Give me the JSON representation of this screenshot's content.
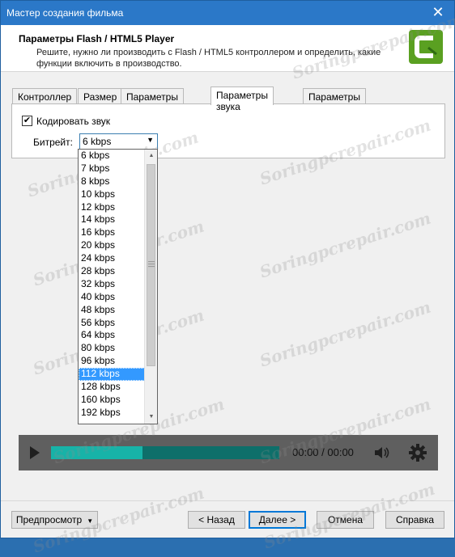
{
  "window": {
    "title": "Мастер создания фильма"
  },
  "header": {
    "title": "Параметры Flash / HTML5 Player",
    "description": "Решите, нужно ли производить с Flash / HTML5 контроллером и определить, какие функции включить в производство."
  },
  "tabs": [
    "Контроллер",
    "Размер",
    "Параметры видео",
    "Параметры звука",
    "Параметры"
  ],
  "active_tab": "Параметры звука",
  "audio": {
    "encode_label": "Кодировать звук",
    "encode_checked": true,
    "bitrate_label": "Битрейт:",
    "bitrate_value": "6 kbps",
    "options": [
      "6 kbps",
      "7 kbps",
      "8 kbps",
      "10 kbps",
      "12 kbps",
      "14 kbps",
      "16 kbps",
      "20 kbps",
      "24 kbps",
      "28 kbps",
      "32 kbps",
      "40 kbps",
      "48 kbps",
      "56 kbps",
      "64 kbps",
      "80 kbps",
      "96 kbps",
      "112 kbps",
      "128 kbps",
      "160 kbps",
      "192 kbps"
    ],
    "highlighted_option": "112 kbps"
  },
  "player": {
    "time": "00:00 / 00:00",
    "progress_fraction": 0.4
  },
  "footer": {
    "preview_label": "Предпросмотр",
    "back_label": "< Назад",
    "next_label": "Далее >",
    "cancel_label": "Отмена",
    "help_label": "Справка"
  },
  "watermark": "Soringpcrepair.com",
  "colors": {
    "titlebar": "#2b78c8",
    "accent_teal": "#17b3a8",
    "logo_green": "#5aa021",
    "selection": "#3399ff"
  }
}
